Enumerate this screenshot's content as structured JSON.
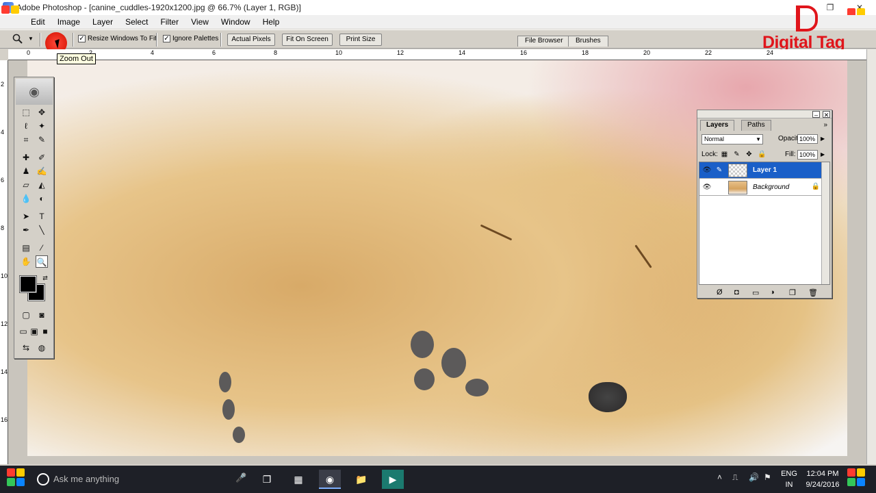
{
  "window": {
    "title": "Adobe Photoshop - [canine_cuddles-1920x1200.jpg @ 66.7% (Layer 1, RGB)]",
    "restore_label": "❐",
    "close_label": "✕"
  },
  "menu": [
    "Edit",
    "Image",
    "Layer",
    "Select",
    "Filter",
    "View",
    "Window",
    "Help"
  ],
  "options": {
    "resize_windows": "Resize Windows To Fit",
    "ignore_palettes": "Ignore Palettes",
    "actual_pixels": "Actual Pixels",
    "fit_on_screen": "Fit On Screen",
    "print_size": "Print Size",
    "file_browser": "File Browser",
    "brushes": "Brushes",
    "resize_checked": "✓",
    "ignore_checked": "✓"
  },
  "tooltip": "Zoom Out",
  "logo": {
    "text": "Digital Tag",
    "color": "#e0151b"
  },
  "ruler_top_labels": [
    "0",
    "2",
    "4",
    "6",
    "8",
    "10",
    "12",
    "14",
    "16",
    "18",
    "20",
    "22",
    "24"
  ],
  "ruler_left_labels": [
    "2",
    "4",
    "6",
    "8",
    "10",
    "12",
    "14",
    "16"
  ],
  "layers_palette": {
    "tab_layers": "Layers",
    "tab_paths": "Paths",
    "blend_mode": "Normal",
    "opacity_label": "Opacity:",
    "opacity_value": "100%",
    "lock_label": "Lock:",
    "fill_label": "Fill:",
    "fill_value": "100%",
    "layers": [
      {
        "name": "Layer 1",
        "selected": true
      },
      {
        "name": "Background",
        "selected": false
      }
    ]
  },
  "taskbar": {
    "search_placeholder": "Ask me anything",
    "lang_line1": "ENG",
    "lang_line2": "IN",
    "time": "12:04 PM",
    "date": "9/24/2016"
  }
}
